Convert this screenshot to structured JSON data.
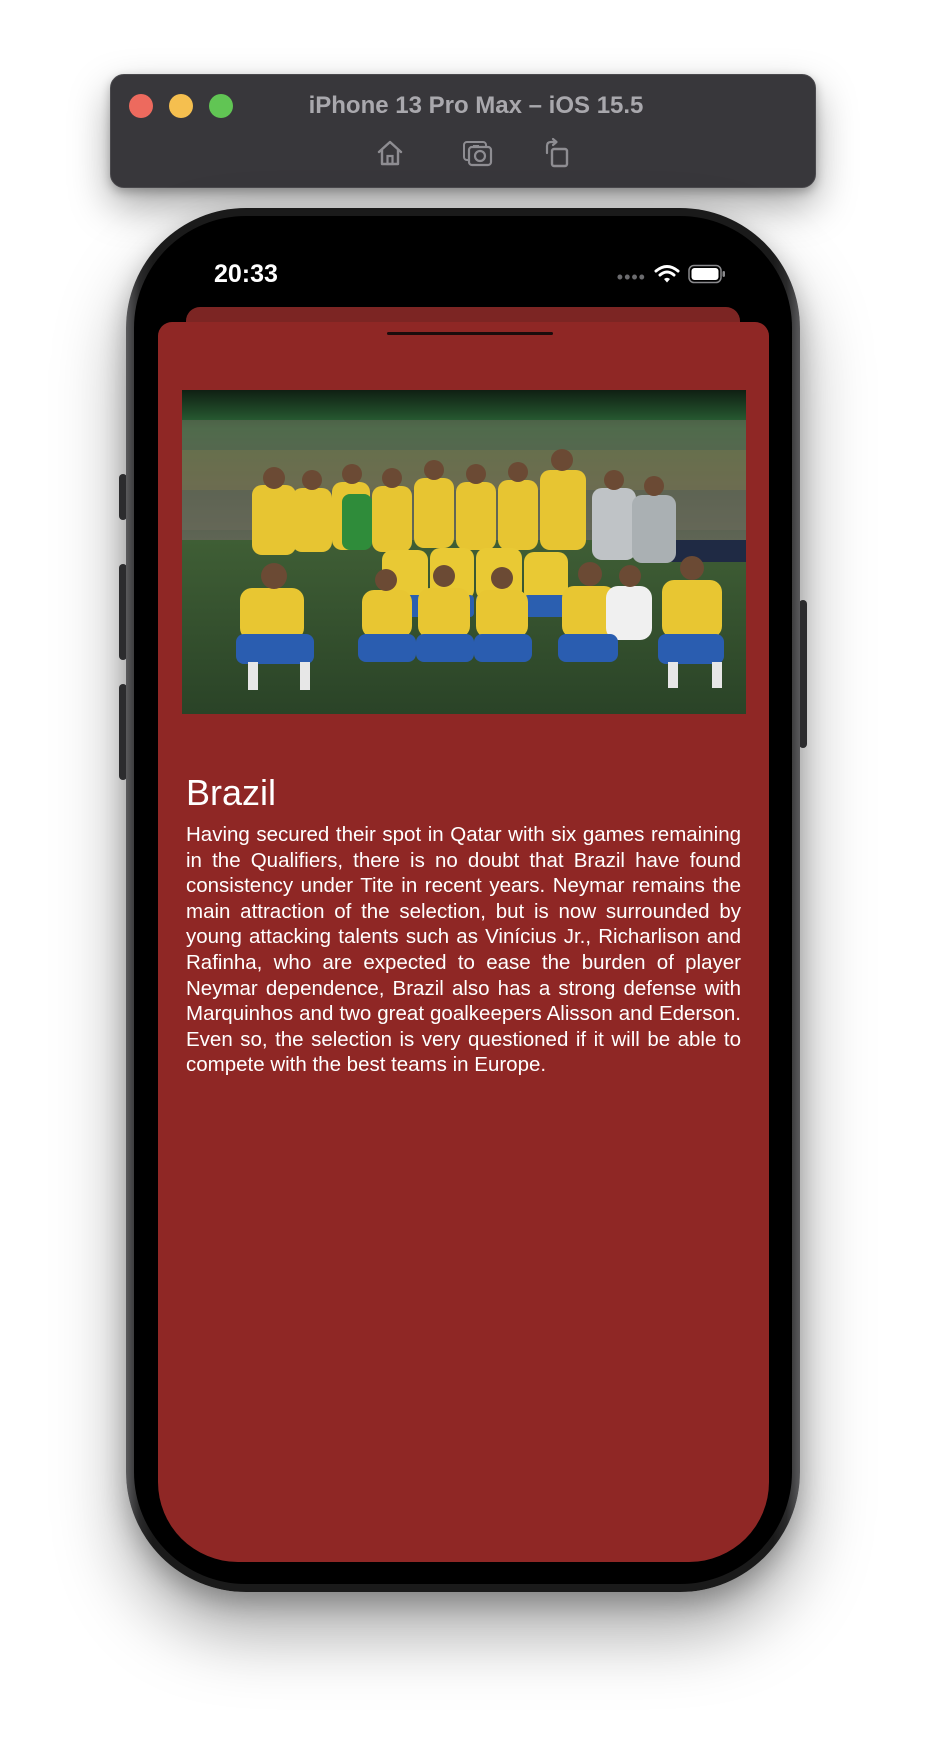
{
  "simulator": {
    "title": "iPhone 13 Pro Max – iOS 15.5",
    "buttons": [
      {
        "name": "home",
        "icon": "house-icon"
      },
      {
        "name": "screenshot",
        "icon": "camera-icon"
      },
      {
        "name": "rotate",
        "icon": "rotate-icon"
      }
    ],
    "traffic_lights": {
      "close": "#ed6a5e",
      "minimize": "#f5bf4f",
      "zoom": "#61c554"
    }
  },
  "status_bar": {
    "time": "20:33",
    "icons": [
      "cellular-dots-icon",
      "wifi-icon",
      "battery-icon"
    ]
  },
  "sheet": {
    "background_color": "#8f2725",
    "image_alt": "Brazil national team celebrating",
    "title": "Brazil",
    "description": "Having secured their spot in Qatar with six games remaining in the Qualifiers, there is no doubt that Brazil have found consistency under Tite in recent years. Neymar remains the main attraction of the selection, but is now surrounded by young attacking talents such as Vinícius Jr., Richarlison and Rafinha, who are expected to ease the burden of player Neymar dependence, Brazil also has a strong defense with Marquinhos and two great goalkeepers Alisson and Ederson. Even so, the selection is very questioned if it will be able to compete with the best teams in Europe."
  }
}
